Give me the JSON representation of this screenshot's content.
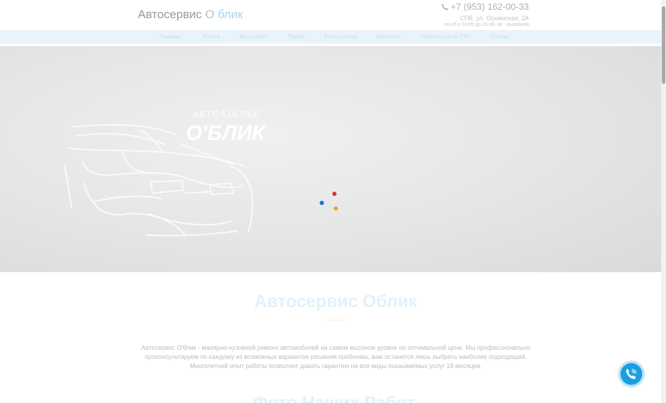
{
  "header": {
    "logo_main": "Автосервис",
    "logo_o": "О",
    "logo_rest": "блик",
    "phone": "+7 (953) 162-00-33",
    "address": "СПб, ул. Оснинская, 2А",
    "hours": "пн-сб с 10:00 до 20:00, вс - выходной"
  },
  "nav": {
    "items": [
      {
        "label": "Главная"
      },
      {
        "label": "Услуги"
      },
      {
        "label": "Фото работ"
      },
      {
        "label": "Прайс"
      },
      {
        "label": "Калькулятор"
      },
      {
        "label": "Контакты"
      },
      {
        "label": "Записаться на СТО"
      },
      {
        "label": "Статьи"
      }
    ]
  },
  "hero": {
    "brand_line1": "АВТОАТЕЛЬЕ",
    "brand_line2": "О'БЛИК",
    "loader_colors": [
      "#d0342c",
      "#1a73c8",
      "#e6a817"
    ]
  },
  "content": {
    "title": "Автосервис Облик",
    "text": "Автосервис О'блик - малярно-кузовной ремонт автомобилей на самом высоком уровне по оптимальной цене. Мы профессионально проконсультируем по каждому из возможных вариантов решения проблемы, вам останется лишь выбрать наиболее подходящий. Многолетний опыт работы позволяет давать гарантию на все виды оказываемых услуг 18 месяцев.",
    "next_title": "Фото Наших Работ"
  },
  "icons": {
    "phone": "phone-icon",
    "call": "call-icon"
  }
}
